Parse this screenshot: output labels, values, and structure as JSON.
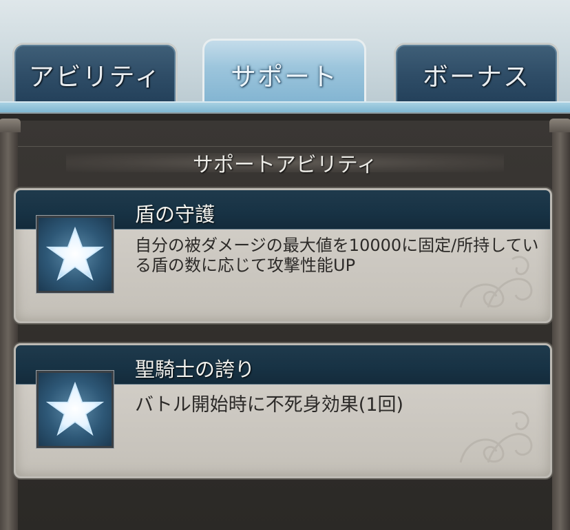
{
  "tabs": [
    {
      "label": "アビリティ",
      "active": false
    },
    {
      "label": "サポート",
      "active": true
    },
    {
      "label": "ボーナス",
      "active": false
    }
  ],
  "section_title": "サポートアビリティ",
  "abilities": [
    {
      "name": "盾の守護",
      "description": "自分の被ダメージの最大値を10000に固定/所持している盾の数に応じて攻撃性能UP",
      "icon": "star-icon"
    },
    {
      "name": "聖騎士の誇り",
      "description": "バトル開始時に不死身効果(1回)",
      "icon": "star-icon"
    }
  ],
  "colors": {
    "active_tab": "#9cc5dc",
    "inactive_tab": "#2e4c66",
    "card_header": "#173244",
    "card_body": "#cdc9c2"
  }
}
